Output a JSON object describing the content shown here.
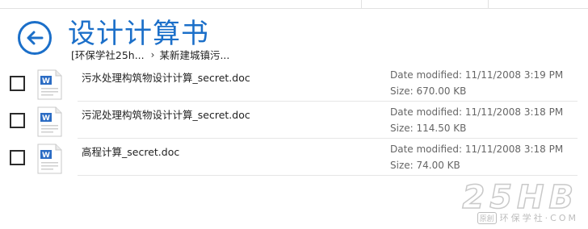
{
  "header": {
    "title": "设计计算书",
    "back_icon": "back-arrow-icon"
  },
  "breadcrumb": {
    "items": [
      "[环保学社25h...",
      "某新建城镇污..."
    ],
    "separator_icon": "chevron-right-icon"
  },
  "files": [
    {
      "name": "污水处理构筑物设计计算_secret.doc",
      "date_modified": "Date modified: 11/11/2008 3:19 PM",
      "size": "Size: 670.00 KB",
      "icon": "word-document-icon"
    },
    {
      "name": "污泥处理构筑物设计计算_secret.doc",
      "date_modified": "Date modified: 11/11/2008 3:18 PM",
      "size": "Size: 114.50 KB",
      "icon": "word-document-icon"
    },
    {
      "name": "高程计算_secret.doc",
      "date_modified": "Date modified: 11/11/2008 3:18 PM",
      "size": "Size: 74.00 KB",
      "icon": "word-document-icon"
    }
  ],
  "watermark": {
    "logo_text": "25HB",
    "badge": "原創",
    "tagline": "环保学社·COM"
  },
  "colors": {
    "accent": "#1b6fc9",
    "text": "#222222",
    "meta_text": "#666666",
    "divider": "#e6e6e6"
  }
}
